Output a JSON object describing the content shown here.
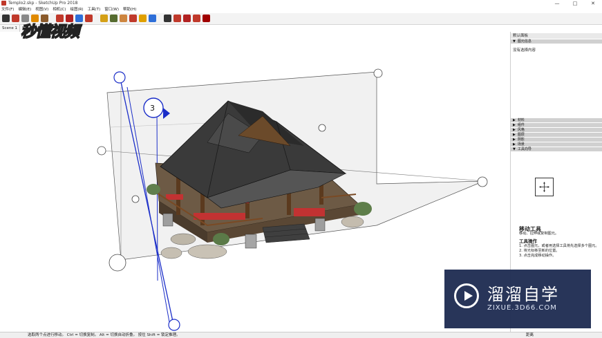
{
  "window": {
    "title": "Templo2.skp - SketchUp Pro 2018",
    "minimize": "—",
    "maximize": "□",
    "close": "✕"
  },
  "menu": [
    "文件(F)",
    "编辑(E)",
    "视图(V)",
    "相机(C)",
    "绘图(R)",
    "工具(T)",
    "窗口(W)",
    "帮助(H)"
  ],
  "tabs": [
    "Scene 1",
    "S"
  ],
  "toolbar_colors": [
    "#333333",
    "#c0392b",
    "#888888",
    "#e08a00",
    "#8a5a2b",
    "#c0392b",
    "#b22222",
    "#2e6fd8",
    "#c0392b",
    "#d4a017",
    "#556b2f",
    "#cd853f",
    "#c0392b",
    "#e0a000",
    "#2e6fd8",
    "#333333",
    "#c0392b",
    "#b22222",
    "#c0392b",
    "#a00000"
  ],
  "panel": {
    "title": "默认面板",
    "entity_info": "图元信息",
    "no_selection": "没有选择内容",
    "sections": [
      "材料",
      "组件",
      "风格",
      "图层",
      "阴影",
      "场景"
    ],
    "instructor": "工具向导"
  },
  "instructor": {
    "tool_name": "移动工具",
    "tool_desc": "移动、拉伸或复制图元。",
    "ops_title": "工具操作",
    "steps": [
      "1. 点击图元，或者用选择工具将先选择多个图元。",
      "2. 将光标移至新的位置。",
      "3. 点击完成移动操作。"
    ]
  },
  "status": {
    "hint": "选取两个点进行移动。 Ctrl = 切换复制。 Alt = 切换自动折叠。 按住 Shift = 锁定推理。",
    "measure_label": "距离"
  },
  "watermarks": {
    "top_left": "秒懂视频",
    "brand": "溜溜自学",
    "url": "ZIXUE.3D66.COM"
  }
}
